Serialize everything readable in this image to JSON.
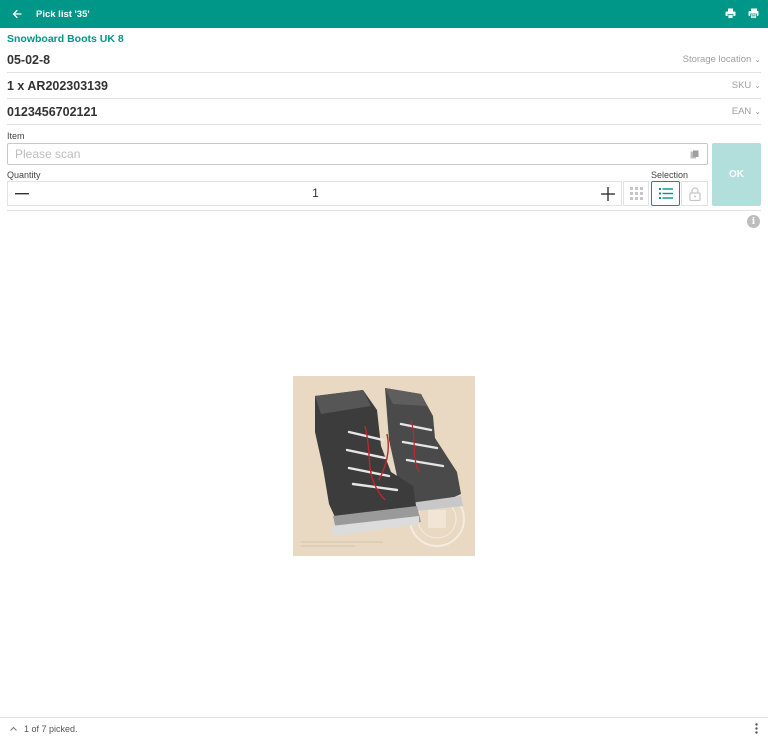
{
  "appbar": {
    "title": "Pick list '35'",
    "icons": {
      "back": "arrow-left-icon",
      "print": "printer-icon",
      "print_list": "print-list-icon"
    },
    "color": "#009688"
  },
  "product": {
    "name": "Snowboard Boots UK 8",
    "rows": [
      {
        "value": "05-02-8",
        "label": "Storage location"
      },
      {
        "value": "1 x AR202303139",
        "label": "SKU"
      },
      {
        "value": "0123456702121",
        "label": "EAN"
      }
    ]
  },
  "item": {
    "label": "Item",
    "placeholder": "Please scan",
    "value": ""
  },
  "quantity": {
    "label": "Quantity",
    "value": "1"
  },
  "selection": {
    "label": "Selection"
  },
  "ok_button": {
    "label": "OK",
    "color": "#b2dfdb"
  },
  "footer": {
    "status": "1 of 7 picked."
  }
}
